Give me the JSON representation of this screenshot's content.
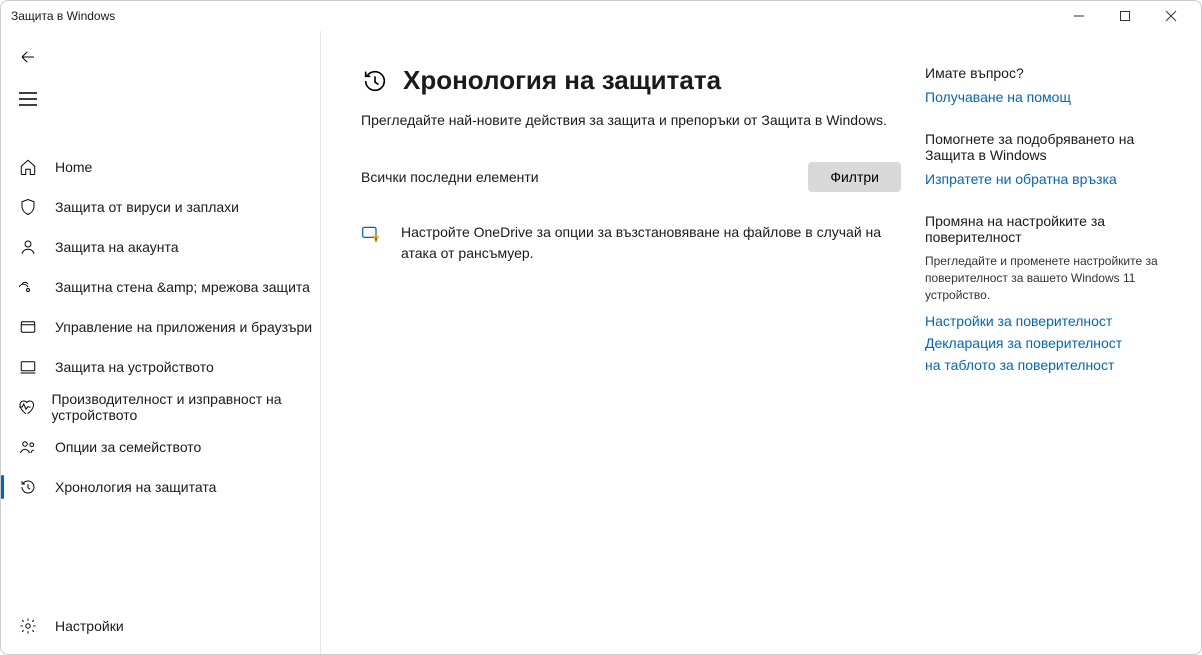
{
  "window": {
    "title": "Защита в Windows"
  },
  "sidebar": {
    "items": [
      {
        "label": "Home"
      },
      {
        "label": "Защита от вируси и заплахи"
      },
      {
        "label": "Защита на акаунта"
      },
      {
        "label": "Защитна стена &amp; мрежова защита"
      },
      {
        "label": "Управление на приложения и браузъри"
      },
      {
        "label": "Защита на устройството"
      },
      {
        "label": "Производителност и изправност на устройството"
      },
      {
        "label": "Опции за семейството"
      },
      {
        "label": "Хронология на защитата"
      }
    ],
    "settings_label": "Настройки"
  },
  "page": {
    "title": "Хронология на защитата",
    "subtitle": "Прегледайте най-новите действия за защита и препоръки от Защита в Windows.",
    "items_header": "Всички последни елементи",
    "filter_label": "Филтри",
    "recommendation": "Настройте OneDrive за опции за възстановяване на файлове в случай на атака от рансъмуер."
  },
  "right": {
    "question": "Имате въпрос?",
    "help_link": "Получаване на помощ",
    "improve_heading": "Помогнете за подобряването на Защита в Windows",
    "feedback_link": "Изпратете ни обратна връзка",
    "privacy_heading": "Промяна на настройките за поверителност",
    "privacy_desc": "Прегледайте и променете настройките за поверителност за вашето Windows 11 устройство.",
    "privacy_link1": "Настройки за поверителност",
    "privacy_link2": "Декларация за поверителност",
    "privacy_link3": "на таблото за поверителност"
  }
}
